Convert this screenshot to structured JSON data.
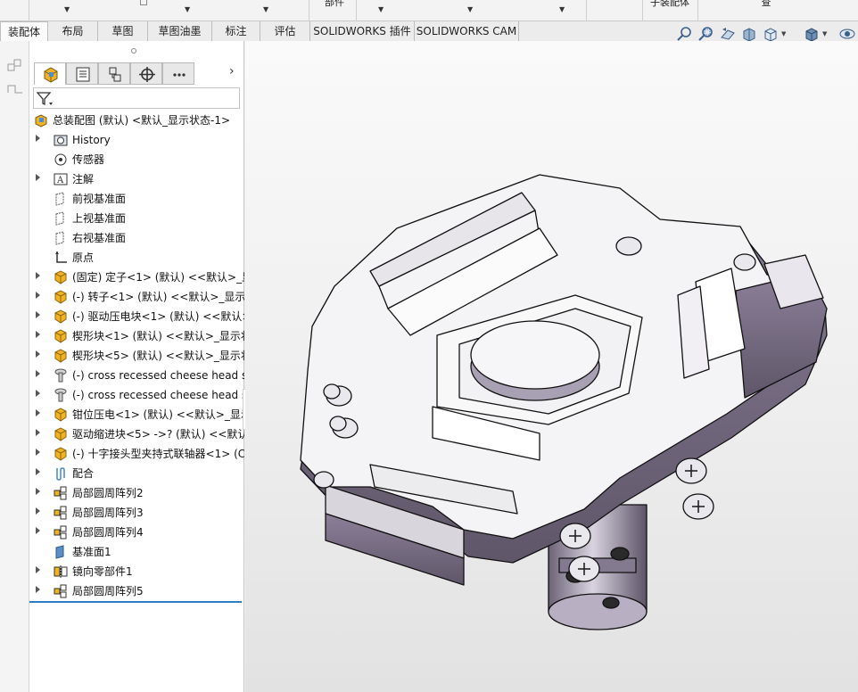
{
  "ribbon_top": {
    "left_label": "部件",
    "sub_asm_label": "子装配体",
    "right_label": "查"
  },
  "tabs": [
    "装配体",
    "布局",
    "草图",
    "草图油墨",
    "标注",
    "评估",
    "SOLIDWORKS 插件",
    "SOLIDWORKS CAM"
  ],
  "active_tab": "装配体",
  "view_toolbar": [
    "zoom-to-fit-icon",
    "zoom-to-area-icon",
    "previous-view-icon",
    "section-view-icon",
    "view-orientation-icon",
    "display-style-icon",
    "hide-show-icon"
  ],
  "feature_manager": {
    "panel_tabs": [
      "featuremanager-tree-icon",
      "property-manager-icon",
      "configuration-manager-icon",
      "dimxpert-icon",
      "more-icon"
    ],
    "tree": [
      {
        "label": "总装配图 (默认) <默认_显示状态-1>",
        "icon": "assembly-icon",
        "expandable": false,
        "indent": 0
      },
      {
        "label": "History",
        "icon": "history-icon",
        "expandable": true,
        "indent": 1
      },
      {
        "label": "传感器",
        "icon": "sensor-icon",
        "expandable": false,
        "indent": 1
      },
      {
        "label": "注解",
        "icon": "annotation-icon",
        "expandable": true,
        "indent": 1
      },
      {
        "label": "前视基准面",
        "icon": "plane-icon",
        "expandable": false,
        "indent": 1
      },
      {
        "label": "上视基准面",
        "icon": "plane-icon",
        "expandable": false,
        "indent": 1
      },
      {
        "label": "右视基准面",
        "icon": "plane-icon",
        "expandable": false,
        "indent": 1
      },
      {
        "label": "原点",
        "icon": "origin-icon",
        "expandable": false,
        "indent": 1
      },
      {
        "label": "(固定) 定子<1> (默认) <<默认>_显",
        "icon": "part-icon",
        "expandable": true,
        "indent": 1
      },
      {
        "label": "(-) 转子<1> (默认) <<默认>_显示",
        "icon": "part-icon",
        "expandable": true,
        "indent": 1
      },
      {
        "label": "(-) 驱动压电块<1> (默认) <<默认>",
        "icon": "part-icon",
        "expandable": true,
        "indent": 1
      },
      {
        "label": "楔形块<1> (默认) <<默认>_显示状",
        "icon": "part-icon",
        "expandable": true,
        "indent": 1
      },
      {
        "label": "楔形块<5> (默认) <<默认>_显示状",
        "icon": "part-icon",
        "expandable": true,
        "indent": 1
      },
      {
        "label": "(-) cross recessed cheese head s",
        "icon": "screw-icon",
        "expandable": true,
        "indent": 1
      },
      {
        "label": "(-) cross recessed cheese head s",
        "icon": "screw-icon",
        "expandable": true,
        "indent": 1
      },
      {
        "label": "钳位压电<1> (默认) <<默认>_显示",
        "icon": "part-icon",
        "expandable": true,
        "indent": 1
      },
      {
        "label": "驱动缩进块<5> ->? (默认) <<默认",
        "icon": "part-icon",
        "expandable": true,
        "indent": 1
      },
      {
        "label": "(-) 十字接头型夹持式联轴器<1> (C",
        "icon": "part-icon",
        "expandable": true,
        "indent": 1
      },
      {
        "label": "配合",
        "icon": "mates-icon",
        "expandable": true,
        "indent": 1
      },
      {
        "label": "局部圆周阵列2",
        "icon": "pattern-icon",
        "expandable": true,
        "indent": 1
      },
      {
        "label": "局部圆周阵列3",
        "icon": "pattern-icon",
        "expandable": true,
        "indent": 1
      },
      {
        "label": "局部圆周阵列4",
        "icon": "pattern-icon",
        "expandable": true,
        "indent": 1
      },
      {
        "label": "基准面1",
        "icon": "plane-solid-icon",
        "expandable": false,
        "indent": 1
      },
      {
        "label": "镜向零部件1",
        "icon": "mirror-icon",
        "expandable": true,
        "indent": 1
      },
      {
        "label": "局部圆周阵列5",
        "icon": "pattern-icon",
        "expandable": true,
        "indent": 1
      }
    ]
  },
  "colors": {
    "accent": "#2e7fc5",
    "part_yellow": "#f0b323",
    "model_purple": "#8c8099"
  }
}
